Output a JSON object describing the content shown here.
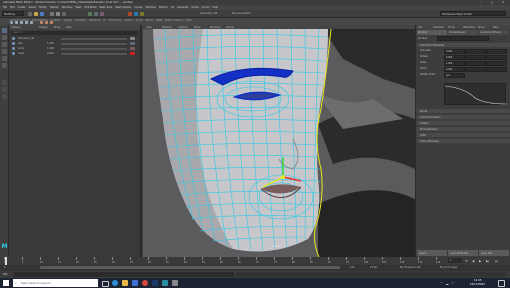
{
  "window": {
    "title": "Autodesk MAYA 2022.1 - Student Version: C:\\Users\\TEMA_1\\Desktop\\Character_Final.mb* --- pCube1",
    "controls": [
      "–",
      "□",
      "✕"
    ]
  },
  "menus": [
    "File",
    "Edit",
    "Create",
    "Select",
    "Modify",
    "Display",
    "Windows",
    "Mesh",
    "Edit Mesh",
    "Mesh Tools",
    "Mesh Display",
    "Curves",
    "Surfaces",
    "Deform",
    "UV",
    "Generate",
    "Cache",
    "Arnold",
    "Help"
  ],
  "status": {
    "mode": "Modeling",
    "workspace": "Workspace: Maya Classic",
    "symmetry": "Symmetry: Off",
    "no_live": "No Live Surface"
  },
  "shelf_tabs": [
    "Curves / Surfaces",
    "Poly Modeling",
    "Sculpting",
    "Rigging",
    "Animation",
    "Rendering",
    "FX",
    "FX Caching",
    "Custom",
    "Arnold",
    "Bifrost",
    "MASH",
    "Motion Graphics",
    "XGen"
  ],
  "outliner": {
    "title": "Outliner",
    "menus": [
      "Display",
      "Show",
      "Help"
    ],
    "search_placeholder": "Search...",
    "items": [
      {
        "name": "Character_ref",
        "value": "",
        "color": "#8a8a8a"
      },
      {
        "name": "hair",
        "value": "1.000",
        "color": "#5c6b7e"
      },
      {
        "name": "body",
        "value": "1.000",
        "color": "#7e5c5c"
      },
      {
        "name": "head",
        "value": "0.000",
        "color": "#d21f1f"
      }
    ]
  },
  "viewport": {
    "menus": [
      "View",
      "Shading",
      "Lighting",
      "Show",
      "Renderer",
      "Panels"
    ],
    "camera_label": "persp",
    "colors": {
      "wire": "#2ec9e6",
      "brows": "#1230c4",
      "highlight": "#e8e820",
      "bg": "#59595b"
    }
  },
  "attribute_editor": {
    "tabs": [
      "List",
      "Selected",
      "Focus",
      "Attributes",
      "Show",
      "Help"
    ],
    "node_tabs": [
      "pCube1",
      "pCubeShape1",
      "polySmoothFace1"
    ],
    "node_label": "pCube1",
    "sections": [
      "Transform Attributes",
      "Pivots",
      "Limit Information",
      "Display",
      "Node Behavior",
      "UUID",
      "Extra Attributes"
    ],
    "fields": [
      {
        "label": "Translate",
        "value": "0.000"
      },
      {
        "label": "Rotate",
        "value": "0.000"
      },
      {
        "label": "Scale",
        "value": "1.000"
      },
      {
        "label": "Shear",
        "value": "0.000"
      },
      {
        "label": "Rotate Order",
        "value": "xyz"
      }
    ],
    "buttons": [
      "Select",
      "Load Attributes",
      "Copy Tab"
    ]
  },
  "timeline": {
    "ticks": [
      "1",
      "5",
      "10",
      "15",
      "20",
      "25",
      "30",
      "35",
      "40",
      "45",
      "50",
      "55",
      "60",
      "65",
      "70",
      "75",
      "80",
      "85",
      "90",
      "95",
      "100",
      "105",
      "110",
      "115",
      "120"
    ],
    "current_frame": "1",
    "range_start": "1",
    "range_end": "120",
    "fps": "24 fps",
    "no_character": "No Character Set",
    "no_anim": "No Anim Layer"
  },
  "command_line": {
    "label": "MEL",
    "text": ""
  },
  "taskbar": {
    "search_placeholder": "Type here to search",
    "time": "12:45",
    "date": "10/17/2022"
  }
}
